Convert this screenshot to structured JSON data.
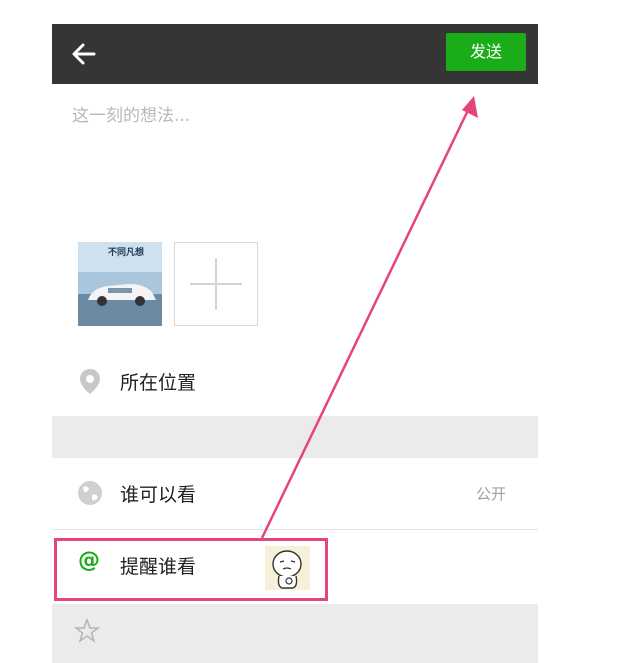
{
  "header": {
    "send_label": "发送"
  },
  "composer": {
    "placeholder": "这一刻的想法..."
  },
  "photo": {
    "caption": "不同凡想"
  },
  "rows": {
    "location": {
      "label": "所在位置"
    },
    "visibility": {
      "label": "谁可以看",
      "value": "公开"
    },
    "remind": {
      "label": "提醒谁看"
    }
  },
  "icons": {
    "back": "arrow-left-icon",
    "location": "location-pin-icon",
    "visibility": "globe-icon",
    "remind": "at-icon",
    "star": "star-icon"
  },
  "colors": {
    "topbar": "#353535",
    "accent": "#1aad19",
    "annotation": "#e6457a"
  }
}
